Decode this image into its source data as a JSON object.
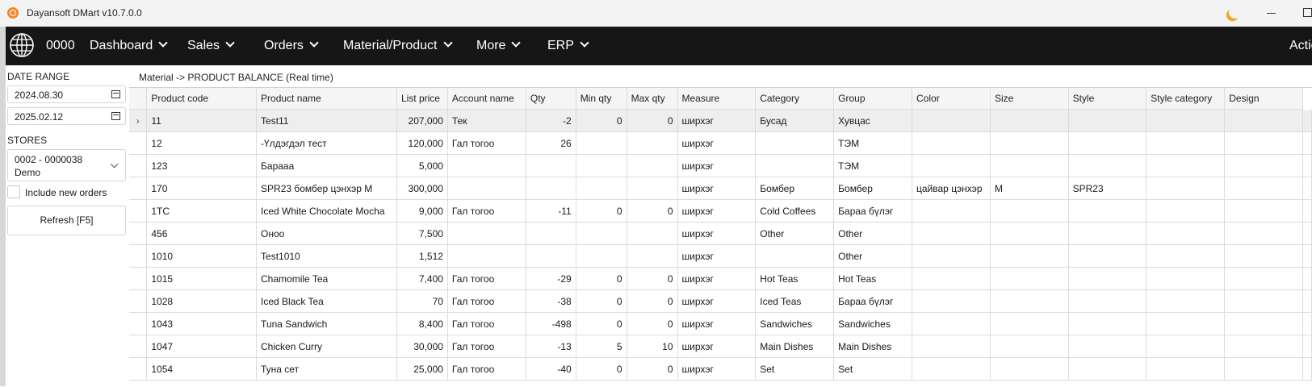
{
  "window": {
    "title": "Dayansoft DMart v10.7.0.0"
  },
  "nav": {
    "code": "0000",
    "items": [
      {
        "label": "Dashboard"
      },
      {
        "label": "Sales"
      },
      {
        "label": "Orders"
      },
      {
        "label": "Material/Product"
      },
      {
        "label": "More"
      },
      {
        "label": "ERP"
      }
    ],
    "actions_label": "Actions"
  },
  "sidebar": {
    "date_range_label": "DATE RANGE",
    "date_from": "2024.08.30",
    "date_to": "2025.02.12",
    "stores_label": "STORES",
    "store_line1": "0002 - 0000038",
    "store_line2": "Demo",
    "include_new_orders": "Include new orders",
    "include_new_orders_checked": false,
    "refresh_label": "Refresh [F5]"
  },
  "breadcrumb": "Material -> PRODUCT BALANCE (Real time)",
  "table": {
    "columns": [
      "Product code",
      "Product name",
      "List price",
      "Account name",
      "Qty",
      "Min qty",
      "Max qty",
      "Measure",
      "Category",
      "Group",
      "Color",
      "Size",
      "Style",
      "Style category",
      "Design"
    ],
    "selected_row_marker": "›",
    "rows": [
      [
        "11",
        "Test11",
        "207,000",
        "Тек",
        "-2",
        "0",
        "0",
        "ширхэг",
        "Бусад",
        "Хувцас",
        "",
        "",
        "",
        "",
        ""
      ],
      [
        "12",
        "-Үлдэгдэл тест",
        "120,000",
        "Гал тогоо",
        "26",
        "",
        "",
        "ширхэг",
        "",
        "ТЭМ",
        "",
        "",
        "",
        "",
        ""
      ],
      [
        "123",
        "Барааа",
        "5,000",
        "",
        "",
        "",
        "",
        "ширхэг",
        "",
        "ТЭМ",
        "",
        "",
        "",
        "",
        ""
      ],
      [
        "170",
        "SPR23 бомбер цэнхэр M",
        "300,000",
        "",
        "",
        "",
        "",
        "ширхэг",
        "Бомбер",
        "Бомбер",
        "цайвар цэнхэр",
        "M",
        "SPR23",
        "",
        ""
      ],
      [
        "1TC",
        "Iced White Chocolate Mocha",
        "9,000",
        "Гал тогоо",
        "-11",
        "0",
        "0",
        "ширхэг",
        "Cold Coffees",
        "Бараа бүлэг",
        "",
        "",
        "",
        "",
        ""
      ],
      [
        "456",
        "Оноо",
        "7,500",
        "",
        "",
        "",
        "",
        "ширхэг",
        "Other",
        "Other",
        "",
        "",
        "",
        "",
        ""
      ],
      [
        "1010",
        "Test1010",
        "1,512",
        "",
        "",
        "",
        "",
        "ширхэг",
        "",
        "Other",
        "",
        "",
        "",
        "",
        ""
      ],
      [
        "1015",
        "Chamomile Tea",
        "7,400",
        "Гал тогоо",
        "-29",
        "0",
        "0",
        "ширхэг",
        "Hot Teas",
        "Hot Teas",
        "",
        "",
        "",
        "",
        ""
      ],
      [
        "1028",
        "Iced Black Tea",
        "70",
        "Гал тогоо",
        "-38",
        "0",
        "0",
        "ширхэг",
        "Iced Teas",
        "Бараа бүлэг",
        "",
        "",
        "",
        "",
        ""
      ],
      [
        "1043",
        "Tuna Sandwich",
        "8,400",
        "Гал тогоо",
        "-498",
        "0",
        "0",
        "ширхэг",
        "Sandwiches",
        "Sandwiches",
        "",
        "",
        "",
        "",
        ""
      ],
      [
        "1047",
        "Chicken Curry",
        "30,000",
        "Гал тогоо",
        "-13",
        "5",
        "10",
        "ширхэг",
        "Main Dishes",
        "Main Dishes",
        "",
        "",
        "",
        "",
        ""
      ],
      [
        "1054",
        "Туна сет",
        "25,000",
        "Гал тогоо",
        "-40",
        "0",
        "0",
        "ширхэг",
        "Set",
        "Set",
        "",
        "",
        "",
        "",
        ""
      ]
    ]
  }
}
